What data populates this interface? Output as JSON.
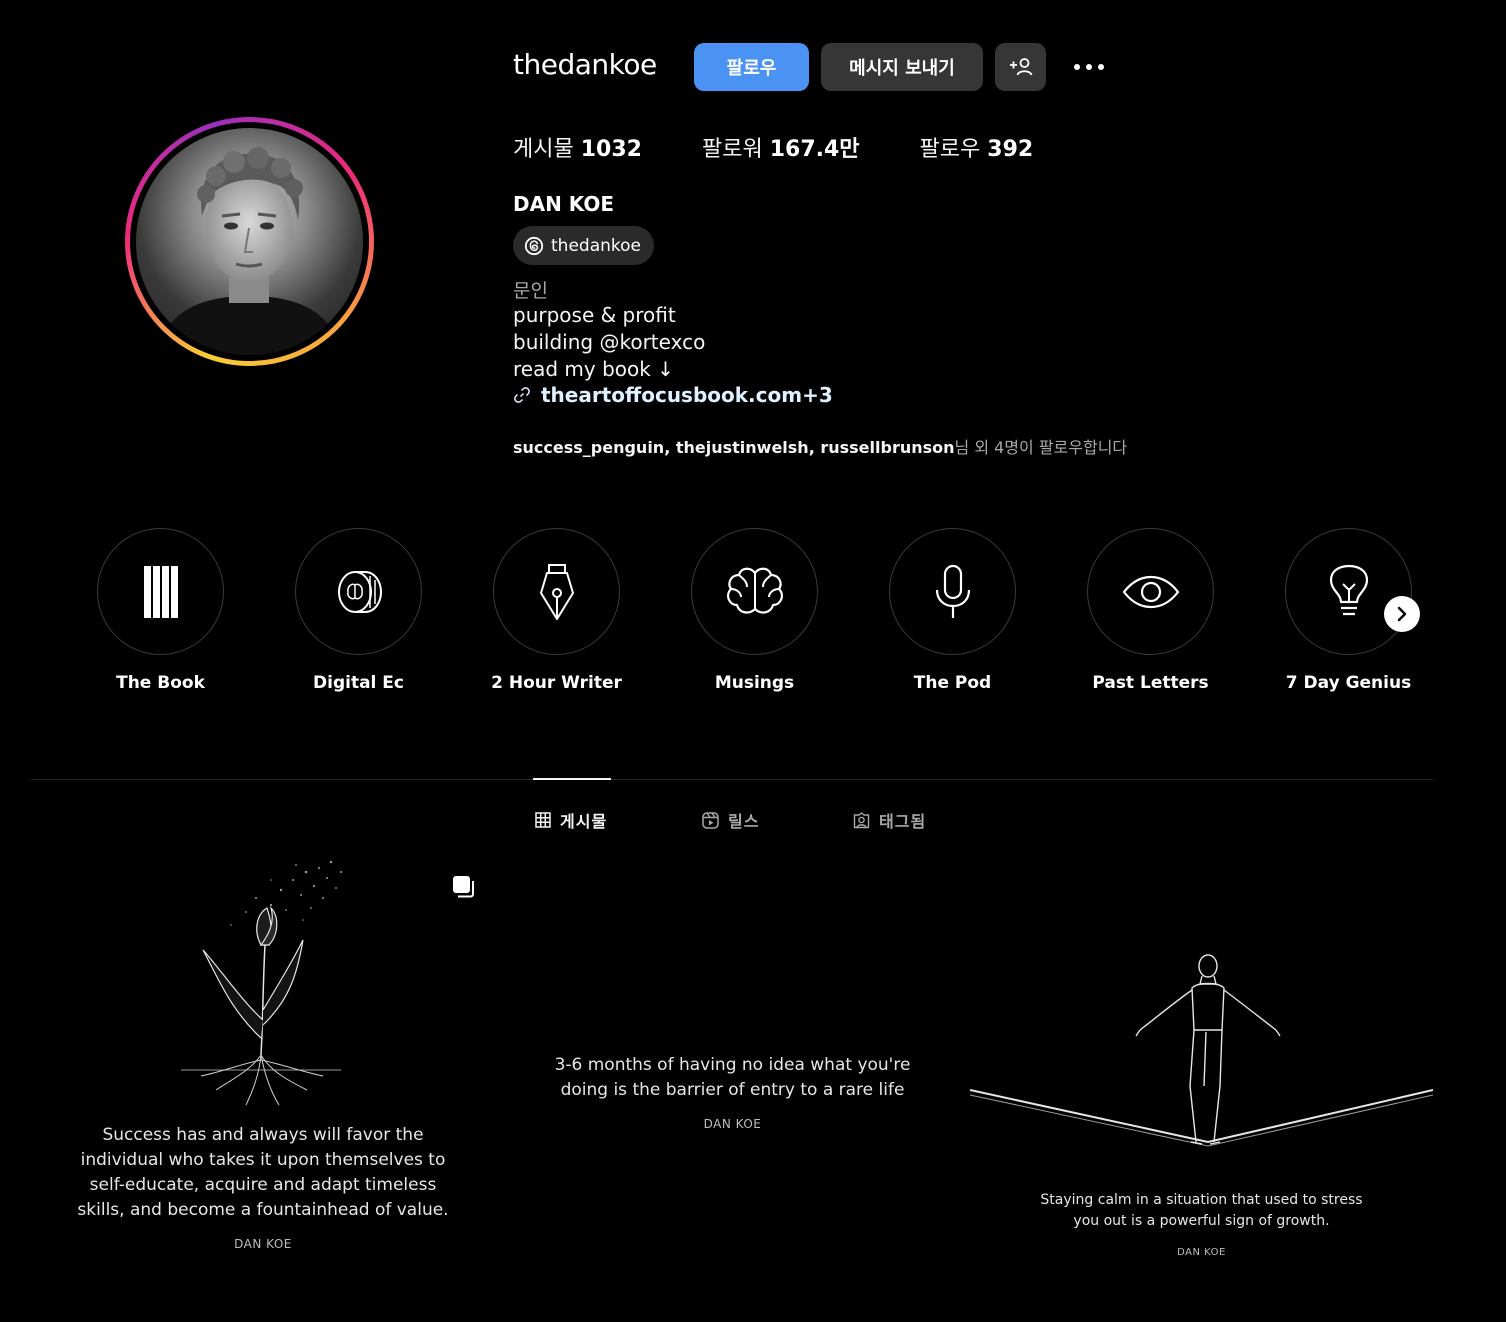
{
  "profile": {
    "username": "thedankoe",
    "full_name": "DAN KOE",
    "threads_handle": "thedankoe",
    "category": "문인",
    "bio_lines": [
      "purpose & profit",
      "building @kortexco",
      "read my book ↓"
    ],
    "link": "theartoffocusbook.com+3"
  },
  "actions": {
    "follow_label": "팔로우",
    "message_label": "메시지 보내기"
  },
  "stats": {
    "posts_label": "게시물",
    "posts_value": "1032",
    "followers_label": "팔로워",
    "followers_value": "167.4만",
    "following_label": "팔로우",
    "following_value": "392"
  },
  "followed_by": {
    "users": "success_penguin, thejustinwelsh, russellbrunson",
    "suffix": "님 외 4명이 팔로우합니다"
  },
  "highlights": [
    {
      "label": "The Book",
      "icon": "book-bars-icon"
    },
    {
      "label": "Digital Ec",
      "icon": "coin-brain-icon"
    },
    {
      "label": "2 Hour Writer",
      "icon": "pen-nib-icon"
    },
    {
      "label": "Musings",
      "icon": "brain-icon"
    },
    {
      "label": "The Pod",
      "icon": "microphone-icon"
    },
    {
      "label": "Past Letters",
      "icon": "eye-icon"
    },
    {
      "label": "7 Day Genius",
      "icon": "lightbulb-icon"
    }
  ],
  "tabs": [
    {
      "label": "게시물",
      "icon": "grid-icon",
      "active": true
    },
    {
      "label": "릴스",
      "icon": "reels-icon",
      "active": false
    },
    {
      "label": "태그됨",
      "icon": "tagged-icon",
      "active": false
    }
  ],
  "posts": [
    {
      "quote": "Success has and always will favor the individual who takes it upon themselves to self-educate, acquire and adapt timeless skills, and become a fountainhead of value.",
      "author": "DAN KOE",
      "multi": true
    },
    {
      "quote": "3-6 months of having no idea what you're doing is the barrier of entry to a rare life",
      "author": "DAN KOE",
      "multi": false
    },
    {
      "quote": "Staying calm in a situation that used to stress you out is a powerful sign of growth.",
      "author": "DAN KOE",
      "multi": false
    }
  ],
  "colors": {
    "background": "#000000",
    "follow_button": "#4a93f2",
    "secondary_button": "#363636",
    "link": "#e0f1ff",
    "muted_text": "#a8a8a8"
  }
}
